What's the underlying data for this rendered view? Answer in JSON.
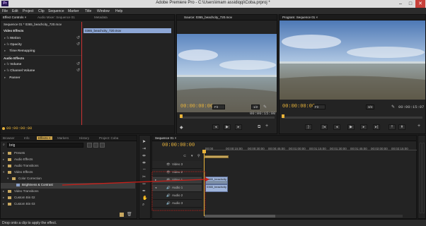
{
  "app": {
    "title": "Adobe Premiere Pro - C:\\Users\\imam assidiqqi\\Coba.prproj *",
    "logo": "Pr"
  },
  "window_controls": {
    "minimize": "–",
    "maximize": "□",
    "close": "✕"
  },
  "menu": [
    "File",
    "Edit",
    "Project",
    "Clip",
    "Sequence",
    "Marker",
    "Title",
    "Window",
    "Help"
  ],
  "effect_controls": {
    "tabs": [
      "Effect Controls ×",
      "Audio Mixer: Sequence 01",
      "Metadata"
    ],
    "header": "Sequence 01 * 0365_beachcity_720.mov",
    "clip_label": "0365_beachcity_720.mov",
    "video_effects": "Video Effects",
    "motion": "Motion",
    "opacity": "Opacity",
    "time_remap": "Time Remapping",
    "audio_effects": "Audio Effects",
    "volume": "Volume",
    "channel_volume": "Channel Volume",
    "panner": "Panner",
    "timecode": "00:00:00:00"
  },
  "source": {
    "tab": "Source: 0365_beachcity_720.mov",
    "timecode": "00:00:00:00",
    "fit": "Fit",
    "res": "1/2",
    "duration": "00:00:15:00"
  },
  "program": {
    "tab": "Program: Sequence 01 ×",
    "timecode": "00:00:00:00",
    "fit": "Fit",
    "res": "3/4",
    "duration": "00:00:15:07"
  },
  "effects_panel": {
    "tabs": [
      "Browser",
      "Info",
      "Effects ×",
      "Markers",
      "History",
      "Project: Coba"
    ],
    "search_value": "brig",
    "items": [
      {
        "label": "Presets",
        "level": 0,
        "expanded": false
      },
      {
        "label": "Audio Effects",
        "level": 0,
        "expanded": false
      },
      {
        "label": "Audio Transitions",
        "level": 0,
        "expanded": false
      },
      {
        "label": "Video Effects",
        "level": 0,
        "expanded": true
      },
      {
        "label": "Color Correction",
        "level": 1,
        "expanded": true
      },
      {
        "label": "Brightness & Contrast",
        "level": 2,
        "expanded": false
      },
      {
        "label": "Video Transitions",
        "level": 0,
        "expanded": false
      },
      {
        "label": "Custom Bin 02",
        "level": 0,
        "expanded": false
      },
      {
        "label": "Custom Bin 03",
        "level": 0,
        "expanded": false
      }
    ]
  },
  "timeline": {
    "tab": "Sequence 01 ×",
    "timecode": "00:00:00:00",
    "ruler": [
      "00:00",
      "00:00:15:00",
      "00:00:30:00",
      "00:00:45:00",
      "00:01:00:00",
      "00:01:15:00",
      "00:01:30:00",
      "00:01:45:00",
      "00:02:00:00",
      "00:02:15:00"
    ],
    "tracks": [
      "Video 3",
      "Video 2",
      "Video 1",
      "Audio 1",
      "Audio 2",
      "Audio 3"
    ],
    "video_clip": "0365_beachcity",
    "audio_clip": "0365_beachcity"
  },
  "status": "Drop onto a clip to apply the effect."
}
